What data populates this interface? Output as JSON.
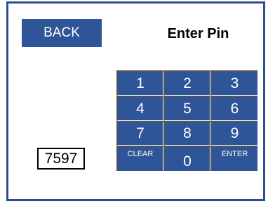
{
  "header": {
    "back_label": "BACK",
    "title": "Enter Pin"
  },
  "pin": {
    "value": "7597"
  },
  "keypad": {
    "keys": [
      "1",
      "2",
      "3",
      "4",
      "5",
      "6",
      "7",
      "8",
      "9",
      "CLEAR",
      "0",
      "ENTER"
    ]
  },
  "colors": {
    "accent": "#2e5597",
    "frame_border": "#2f4f8c"
  }
}
